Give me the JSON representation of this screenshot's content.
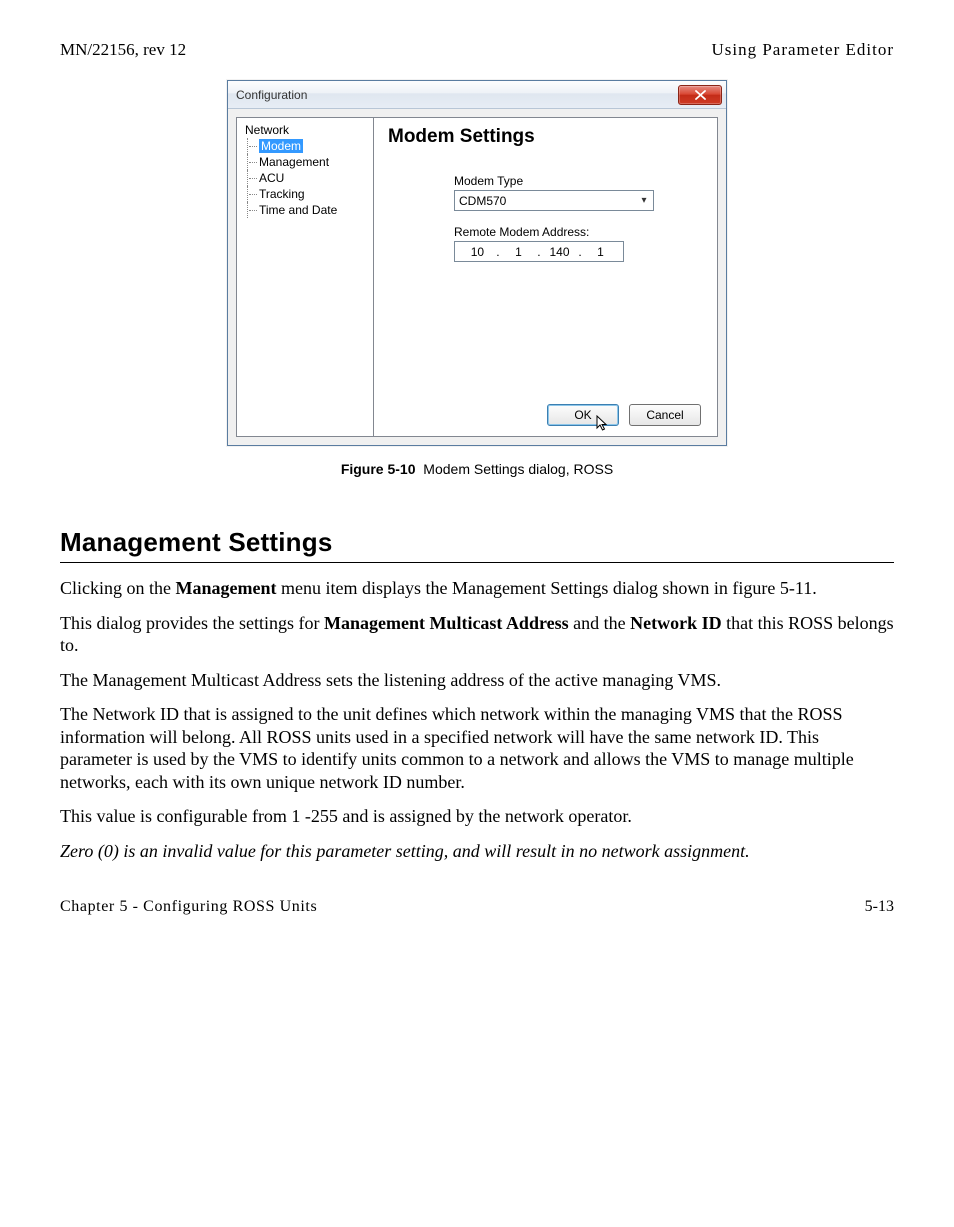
{
  "header": {
    "left": "MN/22156, rev 12",
    "right": "Using Parameter Editor"
  },
  "dialog": {
    "title": "Configuration",
    "tree": {
      "root": "Network",
      "items": [
        "Modem",
        "Management",
        "ACU",
        "Tracking",
        "Time and Date"
      ],
      "selected_index": 0
    },
    "pane_title": "Modem Settings",
    "modem_type_label": "Modem Type",
    "modem_type_value": "CDM570",
    "remote_addr_label": "Remote Modem Address:",
    "ip": {
      "a": "10",
      "b": "1",
      "c": "140",
      "d": "1"
    },
    "ok_label": "OK",
    "cancel_label": "Cancel"
  },
  "figure": {
    "number": "Figure 5-10",
    "caption": "Modem Settings dialog, ROSS"
  },
  "section": {
    "heading": "Management Settings",
    "p1a": "Clicking on the ",
    "p1b": "Management",
    "p1c": " menu item displays the Management Settings dialog shown in figure 5-11.",
    "p2a": "This dialog provides the settings for ",
    "p2b": "Management Multicast Address",
    "p2c": " and the ",
    "p2d": "Network ID",
    "p2e": " that this ROSS belongs to.",
    "p3": "The Management Multicast Address sets the listening address of the active managing VMS.",
    "p4": "The Network ID that is assigned to the unit defines which network within the managing VMS that the ROSS information will belong. All ROSS units used in a specified network will have the same network ID. This parameter is used by the VMS to identify units common to a network and allows the VMS to manage multiple networks, each with its own unique network ID number.",
    "p5": "This value is configurable from 1 -255 and is assigned by the network operator.",
    "p6": "Zero (0) is an invalid value for this parameter setting, and will result in no network assignment."
  },
  "footer": {
    "left": "Chapter 5 - Configuring ROSS Units",
    "right": "5-13"
  }
}
